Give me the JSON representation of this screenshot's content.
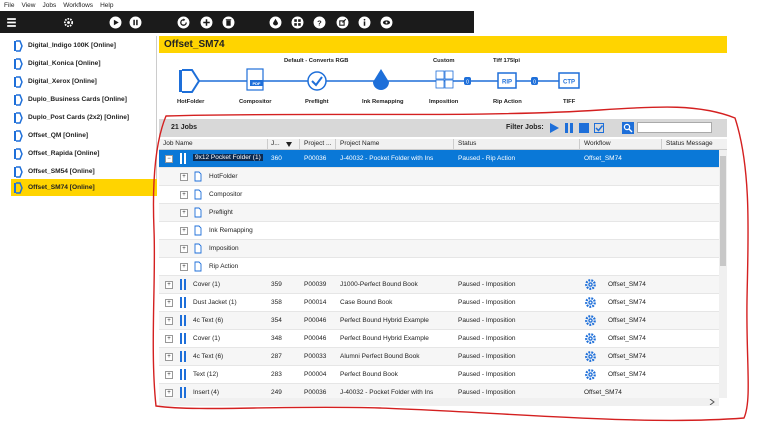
{
  "menu": [
    "File",
    "View",
    "Jobs",
    "Workflows",
    "Help"
  ],
  "toolbar_icons": [
    "menu-icon",
    "settings-icon",
    "play-icon",
    "pause-icon",
    "refresh-icon",
    "add-icon",
    "delete-icon",
    "ink-icon",
    "tree-icon",
    "help-icon",
    "export-icon",
    "info-icon",
    "view-icon"
  ],
  "sidebar": {
    "items": [
      {
        "label": "Digital_Indigo 100K [Online]"
      },
      {
        "label": "Digital_Konica [Online]"
      },
      {
        "label": "Digital_Xerox [Online]"
      },
      {
        "label": "Duplo_Business Cards [Online]"
      },
      {
        "label": "Duplo_Post Cards (2x2) [Online]"
      },
      {
        "label": "Offset_QM [Online]"
      },
      {
        "label": "Offset_Rapida [Online]"
      },
      {
        "label": "Offset_SM54 [Online]"
      },
      {
        "label": "Offset_SM74 [Online]"
      }
    ]
  },
  "title": "Offset_SM74",
  "workflow": {
    "top_labels": {
      "default": "Default - Converts RGB",
      "custom": "Custom",
      "tiff": "Tiff 175lpi"
    },
    "steps": [
      "HotFolder",
      "Compositor",
      "Preflight",
      "Ink Remapping",
      "Imposition",
      "Rip Action",
      "TIFF"
    ],
    "step_texts": {
      "pdf": "PDF",
      "imposition": "1|2|3|4",
      "rip": "RIP",
      "ctp": "CTP",
      "count": "0"
    }
  },
  "jobs_bar": {
    "count": "21 Jobs",
    "filter_label": "Filter Jobs:",
    "search_placeholder": ""
  },
  "columns": [
    "Job Name",
    "J...",
    "Project ...",
    "Project Name",
    "Status",
    "Workflow",
    "Status Message"
  ],
  "jobs_expanded": {
    "name": "9x12 Pocket Folder (1)",
    "j": "360",
    "proj": "P00036",
    "pname": "J-40032 - Pocket Folder with Ins",
    "status": "Paused - Rip Action",
    "workflow": "Offset_SM74",
    "subitems": [
      "HotFolder",
      "Compositor",
      "Preflight",
      "Ink Remapping",
      "Imposition",
      "Rip Action"
    ]
  },
  "jobs": [
    {
      "name": "Cover (1)",
      "j": "359",
      "proj": "P00039",
      "pname": "J1000-Perfect Bound Book",
      "status": "Paused - Imposition",
      "workflow": "Offset_SM74"
    },
    {
      "name": "Dust Jacket (1)",
      "j": "358",
      "proj": "P00014",
      "pname": "Case Bound Book",
      "status": "Paused - Imposition",
      "workflow": "Offset_SM74"
    },
    {
      "name": "4c Text (6)",
      "j": "354",
      "proj": "P00046",
      "pname": "Perfect Bound Hybrid Example",
      "status": "Paused - Imposition",
      "workflow": "Offset_SM74"
    },
    {
      "name": "Cover (1)",
      "j": "348",
      "proj": "P00046",
      "pname": "Perfect Bound Hybrid Example",
      "status": "Paused - Imposition",
      "workflow": "Offset_SM74"
    },
    {
      "name": "4c Text (6)",
      "j": "287",
      "proj": "P00033",
      "pname": "Alumni Perfect Bound Book",
      "status": "Paused - Imposition",
      "workflow": "Offset_SM74"
    },
    {
      "name": "Text (12)",
      "j": "283",
      "proj": "P00004",
      "pname": "Perfect Bound Book",
      "status": "Paused - Imposition",
      "workflow": "Offset_SM74"
    },
    {
      "name": "Insert (4)",
      "j": "249",
      "proj": "P00036",
      "pname": "J-40032 - Pocket Folder with Ins",
      "status": "Paused - Imposition",
      "workflow": "Offset_SM74"
    }
  ],
  "colors": {
    "accent": "#ffd400",
    "selection": "#0a78d7",
    "icon_blue": "#1e6fd9",
    "annotation": "#d42020"
  }
}
